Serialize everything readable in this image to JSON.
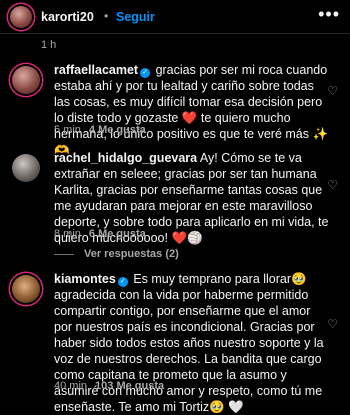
{
  "header": {
    "username": "karorti20",
    "separator": "•",
    "follow_label": "Seguir",
    "more": "•••",
    "post_time": "1 h"
  },
  "comments": [
    {
      "username": "raffaellacamet",
      "verified": true,
      "text": "gracias por ser mi roca cuando estaba ahí y por tu lealtad y cariño sobre todas las cosas, es muy difícil tomar esa decisión pero lo diste todo y gozaste ❤️ te quiero mucho hermana, lo único positivo es que te veré más ✨🫶",
      "time": "5 min",
      "likes": "4 Me gusta"
    },
    {
      "username": "rachel_hidalgo_guevara",
      "verified": false,
      "text": "Ay! Cómo se te va extrañar en seleee; gracias por ser tan humana Karlita, gracias por enseñarme tantas cosas que me ayudaran para mejorar en este maravilloso deporte, y sobre todo para aplicarlo en mi vida, te quiero muchoooooo! ❤️🏐",
      "time": "8 min",
      "likes": "6 Me gusta",
      "view_replies": "Ver respuestas (2)"
    },
    {
      "username": "kiamontes",
      "verified": true,
      "text": "Es muy temprano para llorar🥹 agradecida con la vida por haberme permitido compartir contigo, por enseñarme que el amor por nuestros país es incondicional. Gracias por haber sido todos estos años nuestro soporte y la voz de nuestros derechos. La bandita que cargo como capitana te prometo que la asumo y asumiré con mucho amor y respeto, como tú me enseñaste. Te amo mi Tortiz🥹 🤍",
      "time": "40 min",
      "likes": "103 Me gusta"
    }
  ],
  "icons": {
    "heart": "♡",
    "verified": "✓"
  }
}
